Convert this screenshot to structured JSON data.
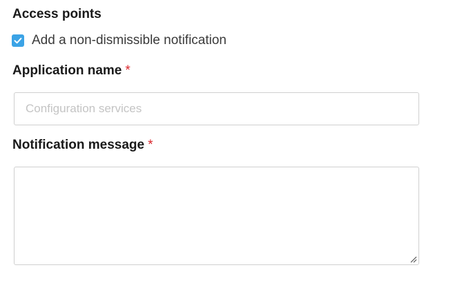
{
  "section": {
    "title": "Access points"
  },
  "notification_checkbox": {
    "label": "Add a non-dismissible notification",
    "checked": true,
    "color": "#3ba3e6"
  },
  "application_name": {
    "label": "Application name",
    "required_mark": "*",
    "value": "",
    "placeholder": "Configuration services"
  },
  "notification_message": {
    "label": "Notification message",
    "required_mark": "*",
    "value": ""
  },
  "icons": {
    "checkbox": "checkmark-icon",
    "resize": "resize-handle-icon"
  },
  "colors": {
    "required": "#d9262c",
    "border": "#cfcfcf",
    "placeholder": "#c4c4c4"
  }
}
